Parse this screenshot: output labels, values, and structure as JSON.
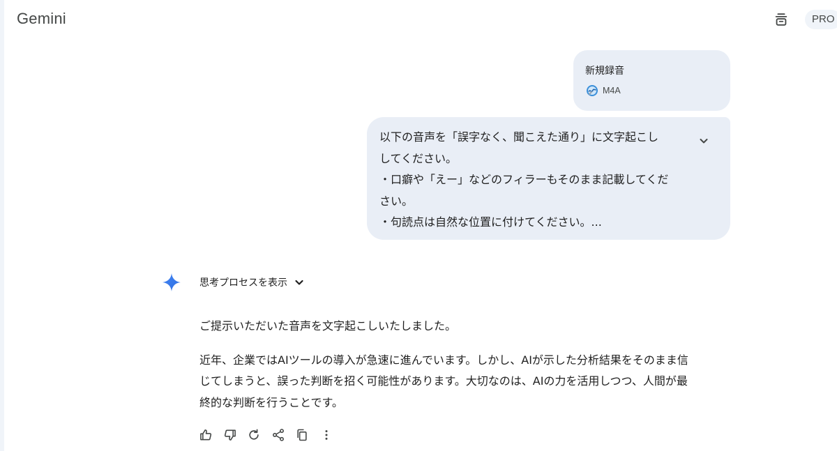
{
  "header": {
    "app_title": "Gemini",
    "action_icon": "archive-icon",
    "plan_badge": "PRO"
  },
  "attachment": {
    "name": "新規録音",
    "type": "M4A",
    "icon": "audio-file-icon"
  },
  "prompt": {
    "lines": [
      "以下の音声を「誤字なく、聞こえた通り」に文字起こし",
      "してください。",
      "・口癖や「えー」などのフィラーもそのまま記載してくだ",
      "さい。",
      "・句読点は自然な位置に付けてください。..."
    ],
    "expand_icon": "chevron-down-icon"
  },
  "response": {
    "thoughts_label": "思考プロセスを表示",
    "intro": "ご提示いただいた音声を文字起こしいたしました。",
    "body_lines": [
      "近年、企業ではAIツールの導入が急速に進んでいます。しかし、AIが示した分析結果をそのまま信",
      "じてしまうと、誤った判断を招く可能性があります。大切なのは、AIの力を活用しつつ、人間が最",
      "終的な判断を行うことです。"
    ]
  },
  "actions": [
    "thumbs-up-icon",
    "thumbs-down-icon",
    "regenerate-icon",
    "share-icon",
    "copy-icon",
    "more-vert-icon"
  ],
  "colors": {
    "bubble": "#e9eef6",
    "badge": "#f0f4f9",
    "spark": "#4285f4",
    "text": "#1f1f1f",
    "icon": "#444746"
  }
}
